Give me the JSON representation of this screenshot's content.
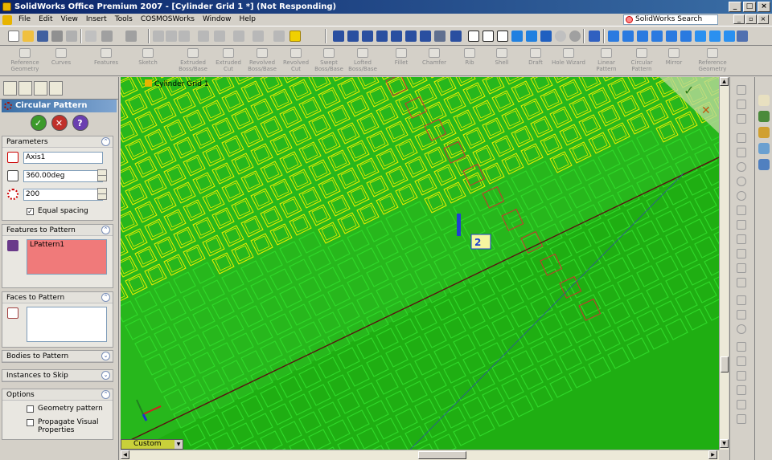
{
  "window": {
    "title": "SolidWorks Office Premium 2007 - [Cylinder Grid 1 *] (Not Responding)"
  },
  "menu": {
    "items": [
      "File",
      "Edit",
      "View",
      "Insert",
      "Tools",
      "COSMOSWorks",
      "Window",
      "Help"
    ],
    "search_label": "SolidWorks Search"
  },
  "command_manager": {
    "items": [
      [
        "Reference",
        "Geometry"
      ],
      [
        "Curves",
        ""
      ],
      [
        "Features",
        ""
      ],
      [
        "Sketch",
        ""
      ],
      [
        "Extruded",
        "Boss/Base"
      ],
      [
        "Extruded",
        "Cut"
      ],
      [
        "Revolved",
        "Boss/Base"
      ],
      [
        "Revolved",
        "Cut"
      ],
      [
        "Swept",
        "Boss/Base"
      ],
      [
        "Lofted",
        "Boss/Base"
      ],
      [
        "Fillet",
        ""
      ],
      [
        "Chamfer",
        ""
      ],
      [
        "Rib",
        ""
      ],
      [
        "Shell",
        ""
      ],
      [
        "Draft",
        ""
      ],
      [
        "Hole Wizard",
        ""
      ],
      [
        "Linear",
        "Pattern"
      ],
      [
        "Circular",
        "Pattern"
      ],
      [
        "Mirror",
        ""
      ],
      [
        "Reference",
        "Geometry"
      ]
    ]
  },
  "property_manager": {
    "title": "Circular Pattern",
    "parameters": {
      "header": "Parameters",
      "axis_value": "Axis1",
      "angle_value": "360.00deg",
      "instances_value": "200",
      "equal_spacing_label": "Equal spacing",
      "equal_spacing_checked": true
    },
    "features": {
      "header": "Features to Pattern",
      "items": [
        "LPattern1"
      ]
    },
    "faces": {
      "header": "Faces to Pattern"
    },
    "bodies": {
      "header": "Bodies to Pattern"
    },
    "skip": {
      "header": "Instances to Skip"
    },
    "options": {
      "header": "Options",
      "geometry_pattern_label": "Geometry pattern",
      "propagate_label": "Propagate Visual Properties"
    }
  },
  "graphics": {
    "tree_label": "Cylinder Grid 1",
    "view_orientation": "Custom",
    "background_color": "#27b71c",
    "grid_color": "#f0f000",
    "callout_text": "2"
  },
  "colors": {
    "title_bar": "#0a246a",
    "selection_fill": "#f07a7a"
  }
}
